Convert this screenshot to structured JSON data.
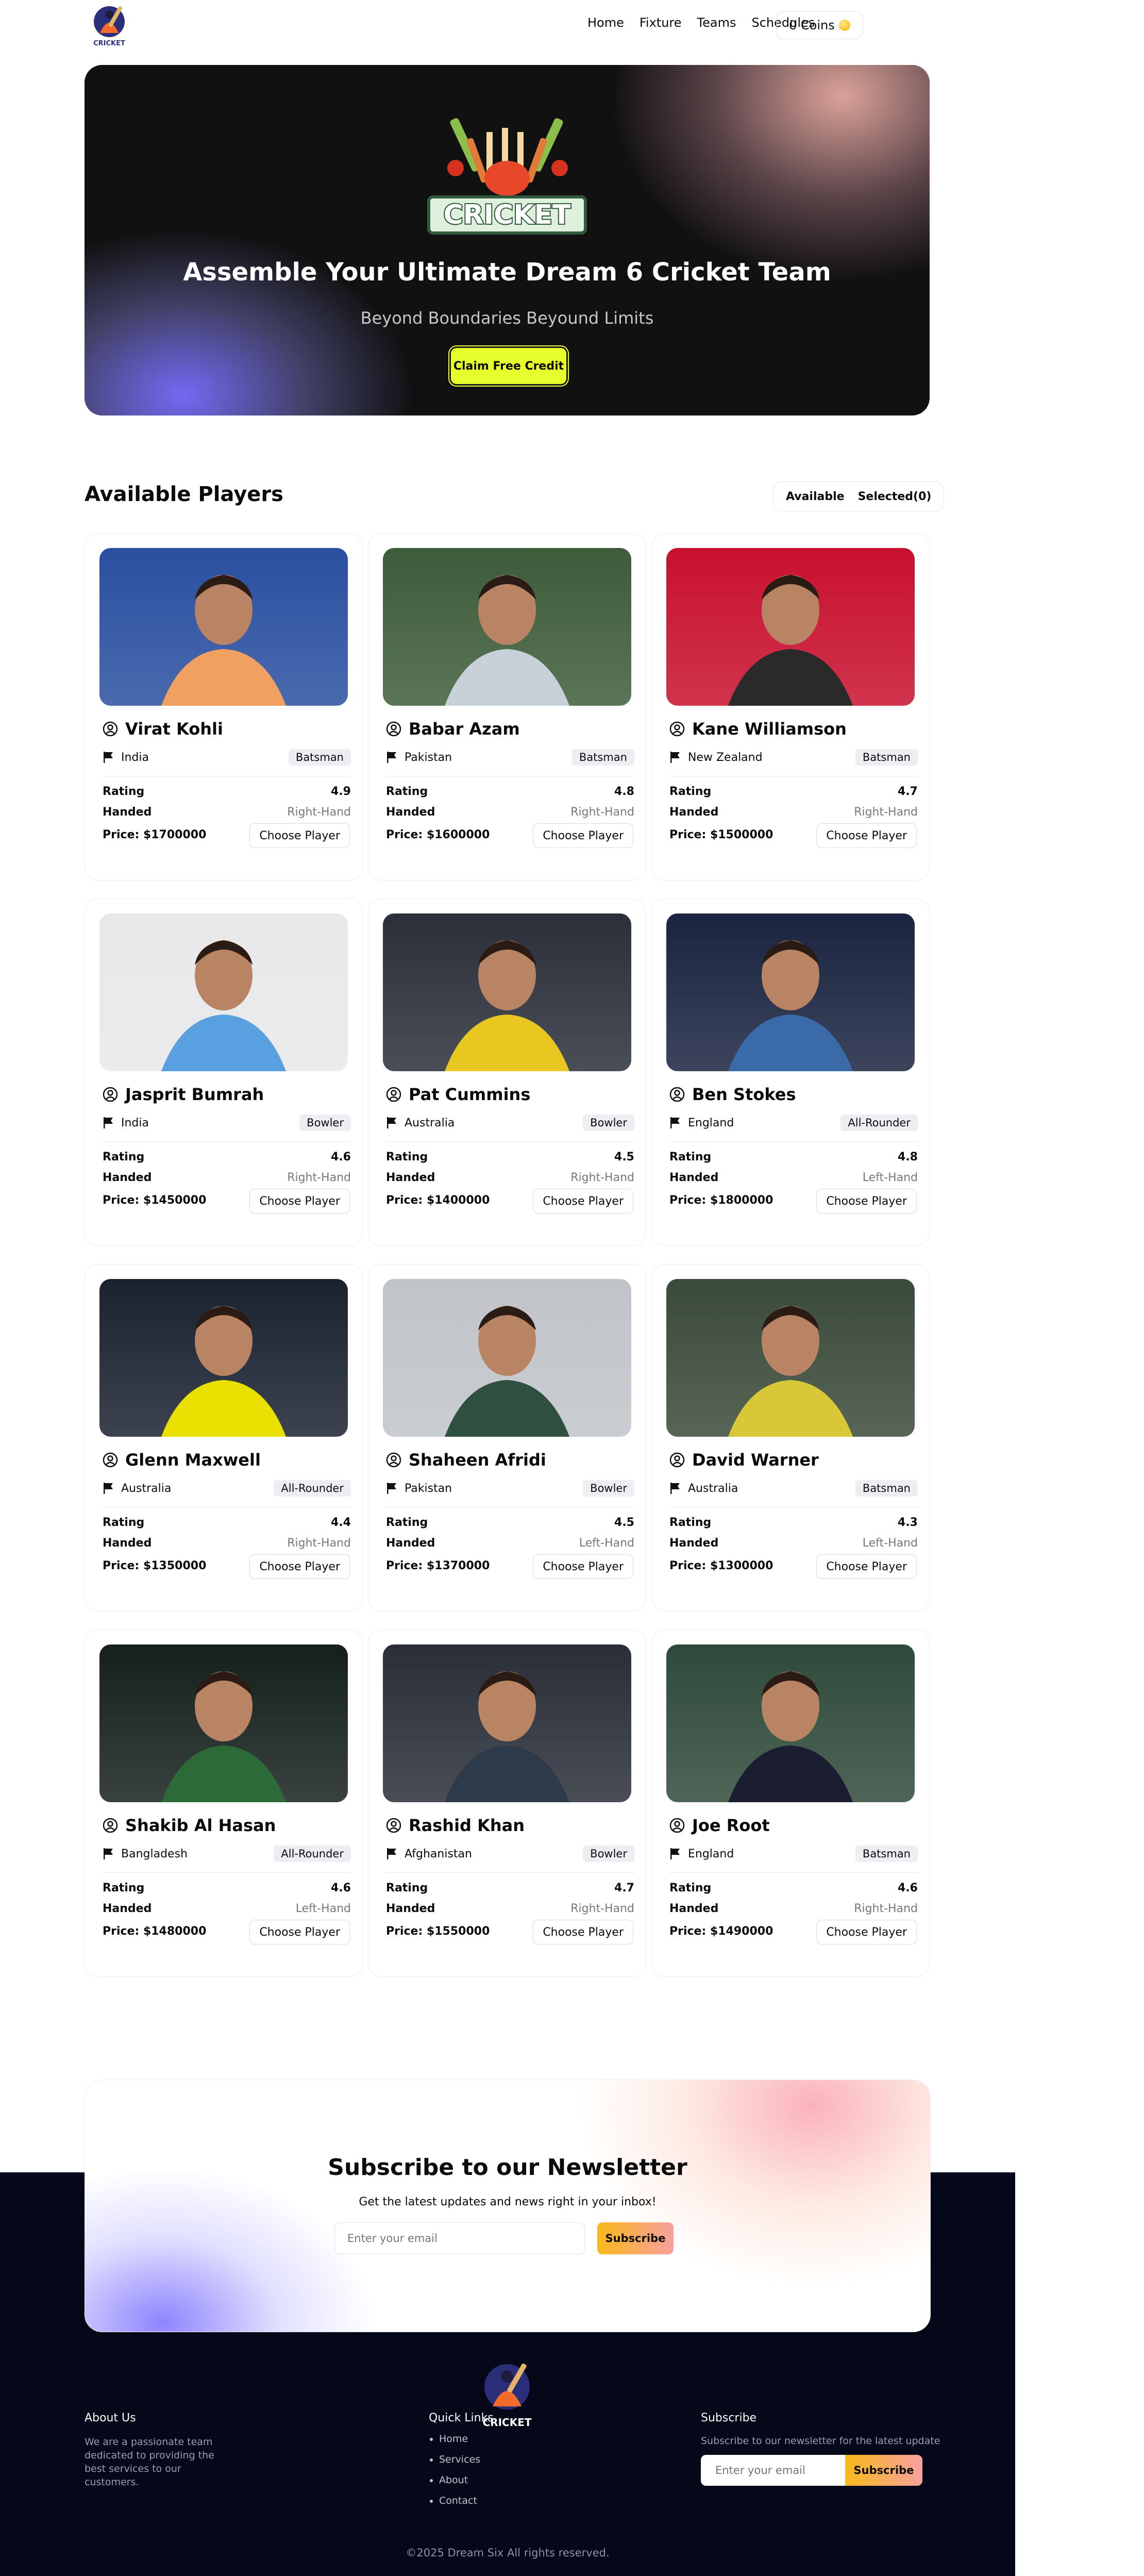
{
  "nav": {
    "logo_text": "CRICKET",
    "menu": [
      "Home",
      "Fixture",
      "Teams",
      "Schedules"
    ],
    "coins_label": "0 Coins"
  },
  "hero": {
    "logo_text": "CRICKET",
    "title": "Assemble Your Ultimate Dream 6 Cricket Team",
    "subtitle": "Beyond Boundaries Beyound Limits",
    "cta": "Claim Free Credit"
  },
  "players_section": {
    "title": "Available Players",
    "toggle_available": "Available",
    "toggle_selected": "Selected(0)",
    "rating_label": "Rating",
    "handed_label": "Handed",
    "price_prefix": "Price: ",
    "choose_label": "Choose Player"
  },
  "players": [
    {
      "name": "Virat Kohli",
      "country": "India",
      "role": "Batsman",
      "rating": "4.9",
      "handed": "Right-Hand",
      "price": "$1700000"
    },
    {
      "name": "Babar Azam",
      "country": "Pakistan",
      "role": "Batsman",
      "rating": "4.8",
      "handed": "Right-Hand",
      "price": "$1600000"
    },
    {
      "name": "Kane Williamson",
      "country": "New Zealand",
      "role": "Batsman",
      "rating": "4.7",
      "handed": "Right-Hand",
      "price": "$1500000"
    },
    {
      "name": "Jasprit Bumrah",
      "country": "India",
      "role": "Bowler",
      "rating": "4.6",
      "handed": "Right-Hand",
      "price": "$1450000"
    },
    {
      "name": "Pat Cummins",
      "country": "Australia",
      "role": "Bowler",
      "rating": "4.5",
      "handed": "Right-Hand",
      "price": "$1400000"
    },
    {
      "name": "Ben Stokes",
      "country": "England",
      "role": "All-Rounder",
      "rating": "4.8",
      "handed": "Left-Hand",
      "price": "$1800000"
    },
    {
      "name": "Glenn Maxwell",
      "country": "Australia",
      "role": "All-Rounder",
      "rating": "4.4",
      "handed": "Right-Hand",
      "price": "$1350000"
    },
    {
      "name": "Shaheen Afridi",
      "country": "Pakistan",
      "role": "Bowler",
      "rating": "4.5",
      "handed": "Left-Hand",
      "price": "$1370000"
    },
    {
      "name": "David Warner",
      "country": "Australia",
      "role": "Batsman",
      "rating": "4.3",
      "handed": "Left-Hand",
      "price": "$1300000"
    },
    {
      "name": "Shakib Al Hasan",
      "country": "Bangladesh",
      "role": "All-Rounder",
      "rating": "4.6",
      "handed": "Left-Hand",
      "price": "$1480000"
    },
    {
      "name": "Rashid Khan",
      "country": "Afghanistan",
      "role": "Bowler",
      "rating": "4.7",
      "handed": "Right-Hand",
      "price": "$1550000"
    },
    {
      "name": "Joe Root",
      "country": "England",
      "role": "Batsman",
      "rating": "4.6",
      "handed": "Right-Hand",
      "price": "$1490000"
    }
  ],
  "newsletter": {
    "title": "Subscribe to our Newsletter",
    "subtitle": "Get the latest updates and news right in your inbox!",
    "placeholder": "Enter your email",
    "button": "Subscribe"
  },
  "footer": {
    "logo_text": "CRICKET",
    "about_title": "About Us",
    "about_text": "We are a passionate team dedicated to providing the best services to our customers.",
    "links_title": "Quick Links",
    "links": [
      "Home",
      "Services",
      "About",
      "Contact"
    ],
    "subscribe_title": "Subscribe",
    "subscribe_text": "Subscribe to our newsletter for the latest update",
    "placeholder": "Enter your email",
    "button": "Subscribe",
    "copyright": "©2025 Dream Six All rights reserved."
  },
  "colors": {
    "accent_yellow": "#e6ff2c",
    "footer_bg": "#050818",
    "button_gradient": [
      "#f9b91a",
      "#f7a0a0"
    ]
  }
}
